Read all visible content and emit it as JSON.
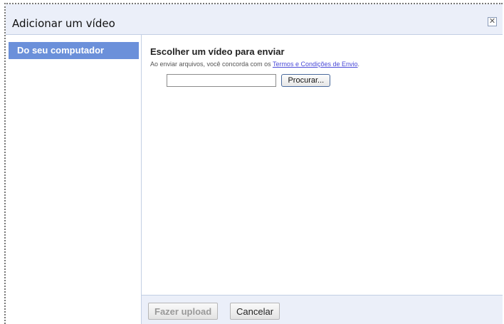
{
  "dialog": {
    "title": "Adicionar um vídeo",
    "close_symbol": "✕"
  },
  "sidebar": {
    "items": [
      {
        "label": "Do seu computador",
        "selected": true
      }
    ]
  },
  "main": {
    "heading": "Escolher um vídeo para enviar",
    "terms_text": "Ao enviar arquivos, você concorda com os ",
    "terms_link": "Termos e Condições de Envio",
    "terms_suffix": ".",
    "file_value": "",
    "browse_label": "Procurar..."
  },
  "footer": {
    "upload_label": "Fazer upload",
    "cancel_label": "Cancelar"
  },
  "colors": {
    "accent": "#6b90da",
    "panel_bg": "#ebeff9",
    "link": "#4a4ad8"
  }
}
